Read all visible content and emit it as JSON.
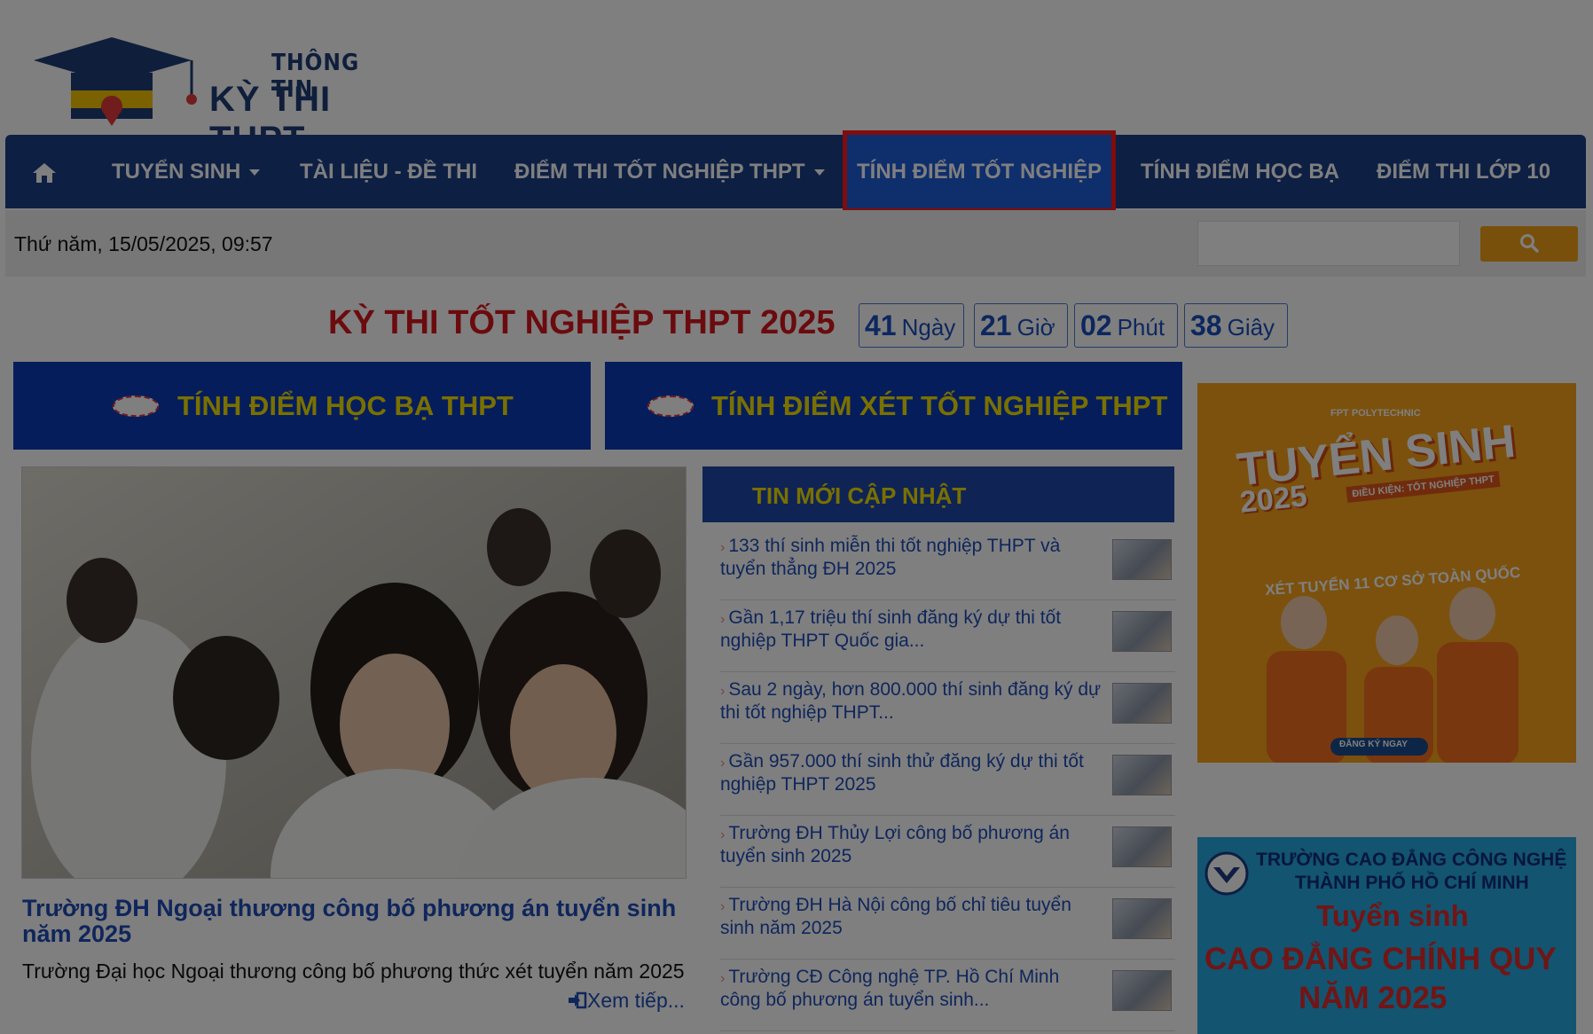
{
  "logo": {
    "line1": "THÔNG TIN",
    "line2": "KỲ THI THPT"
  },
  "nav": {
    "items": [
      {
        "label": "TUYỂN SINH",
        "dropdown": true
      },
      {
        "label": "TÀI LIỆU - ĐỀ THI",
        "dropdown": false
      },
      {
        "label": "ĐIỂM THI TỐT NGHIỆP THPT",
        "dropdown": true
      },
      {
        "label": "TÍNH ĐIỂM TỐT NGHIỆP",
        "dropdown": false,
        "active": true
      },
      {
        "label": "TÍNH ĐIỂM HỌC BẠ",
        "dropdown": false
      },
      {
        "label": "ĐIỂM THI LỚP 10",
        "dropdown": false
      }
    ]
  },
  "datebar": {
    "date_text": "Thứ năm, 15/05/2025, 09:57",
    "search_placeholder": ""
  },
  "countdown": {
    "title": "KỲ THI TỐT NGHIỆP THPT 2025",
    "days": "41",
    "days_unit": "Ngày",
    "hours": "21",
    "hours_unit": "Giờ",
    "minutes": "02",
    "minutes_unit": "Phút",
    "seconds": "38",
    "seconds_unit": "Giây"
  },
  "banners": {
    "left": "TÍNH ĐIỂM HỌC BẠ THPT",
    "right": "TÍNH ĐIỂM XÉT TỐT NGHIỆP THPT"
  },
  "featured": {
    "title": "Trường ĐH Ngoại thương công bố phương án tuyển sinh năm 2025",
    "description": "Trường Đại học Ngoại thương công bố phương thức xét tuyển năm 2025",
    "read_more": "Xem tiếp..."
  },
  "news": {
    "heading": "TIN MỚI CẬP NHẬT",
    "items": [
      "133 thí sinh miễn thi tốt nghiệp THPT và tuyển thẳng ĐH 2025",
      "Gần 1,17 triệu thí sinh đăng ký dự thi tốt nghiệp THPT Quốc gia...",
      "Sau 2 ngày, hơn 800.000 thí sinh đăng ký dự thi tốt nghiệp THPT...",
      "Gần 957.000 thí sinh thử đăng ký dự thi tốt nghiệp THPT 2025",
      "Trường ĐH Thủy Lợi công bố phương án tuyển sinh 2025",
      "Trường ĐH Hà Nội công bố chỉ tiêu tuyển sinh năm 2025",
      "Trường CĐ Công nghệ TP. Hồ Chí Minh công bố phương án tuyển sinh..."
    ]
  },
  "ads": {
    "ad1": {
      "brand": "FPT POLYTECHNIC",
      "headline": "TUYỂN SINH",
      "year": "2025",
      "condition": "ĐIỀU KIỆN: TỐT NGHIỆP THPT",
      "footer": "XÉT TUYỂN 11 CƠ SỞ TOÀN QUỐC",
      "cta": "ĐĂNG KÝ NGAY"
    },
    "ad2": {
      "line1": "TRƯỜNG CAO ĐẲNG CÔNG NGHỆ",
      "line2": "THÀNH PHỐ HỒ CHÍ MINH",
      "line3": "Tuyển sinh",
      "line4": "CAO ĐẲNG CHÍNH QUY",
      "line5": "NĂM 2025"
    }
  },
  "colors": {
    "nav_bg": "#1a3e86",
    "active_bg": "#1f5cd9",
    "highlight": "#ff1a1a",
    "accent_yellow": "#f2e000",
    "title_red": "#d6161c",
    "search_btn": "#f0a019"
  }
}
